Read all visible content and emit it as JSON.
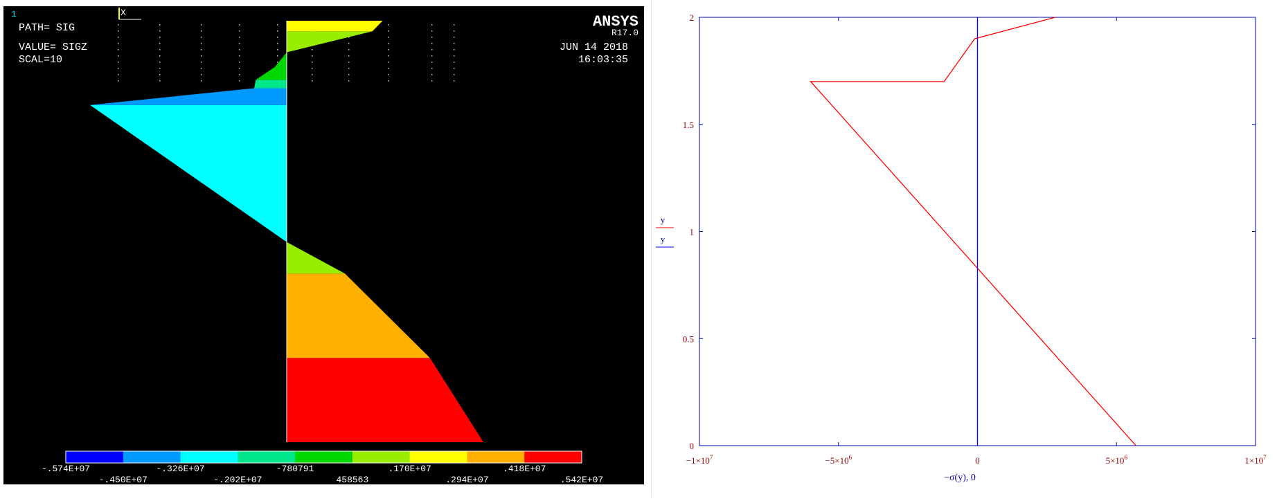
{
  "ansys": {
    "window_number": "1",
    "triad_label": "X",
    "logo": "ANSYS",
    "version": "R17.0",
    "path_line": "PATH=  SIG",
    "value_line": "VALUE= SIGZ",
    "scale_line": "SCAL=10",
    "date": "JUN 14 2018",
    "time": "16:03:35",
    "legend_colors": [
      "#0000ff",
      "#0099ff",
      "#00ffff",
      "#00e68a",
      "#00d600",
      "#99ee00",
      "#ffff00",
      "#ffb000",
      "#ff0000"
    ],
    "legend_labels_top": [
      "-.574E+07",
      "-.326E+07",
      "-780791",
      ".170E+07",
      ".418E+07"
    ],
    "legend_labels_bottom": [
      "-.450E+07",
      "-.202E+07",
      "458563",
      ".294E+07",
      ".542E+07"
    ]
  },
  "mathcad": {
    "legend": [
      {
        "name": "y",
        "color": "#ff0000"
      },
      {
        "name": "y",
        "color": "#0000ff"
      }
    ]
  },
  "chart_data": [
    {
      "type": "area",
      "title": "",
      "xlabel": "",
      "ylabel": "",
      "ylim": [
        0,
        2
      ],
      "xlim": [
        -5740000,
        5420000
      ],
      "series": [
        {
          "points": [
            [
              5740000,
              0
            ],
            [
              4180000,
              0.4
            ],
            [
              1700000,
              0.8
            ],
            [
              0,
              0.95
            ],
            [
              -5740000,
              1.6
            ],
            [
              -5740000,
              1.6
            ],
            [
              -950000,
              1.68
            ],
            [
              -900000,
              1.72
            ],
            [
              -350000,
              1.78
            ],
            [
              0,
              1.85
            ],
            [
              2500000,
              1.95
            ],
            [
              2800000,
              2.0
            ]
          ]
        }
      ]
    },
    {
      "type": "line",
      "title": "",
      "xlabel": "−σ(y), 0",
      "ylabel": "",
      "xlim": [
        -10000000,
        10000000
      ],
      "ylim": [
        0,
        2
      ],
      "x_ticks": [
        "−1×10^7",
        "−5×10^6",
        "0",
        "5×10^6",
        "1×10^7"
      ],
      "y_ticks": [
        "0",
        "0.5",
        "1",
        "1.5",
        "2"
      ],
      "series": [
        {
          "name": "y",
          "x": [
            5700000,
            -6000000,
            -1200000,
            -100000,
            2800000
          ],
          "y": [
            0,
            1.7,
            1.7,
            1.9,
            2.0
          ]
        },
        {
          "name": "y",
          "x": [
            0,
            0
          ],
          "y": [
            0,
            2
          ]
        }
      ]
    }
  ]
}
